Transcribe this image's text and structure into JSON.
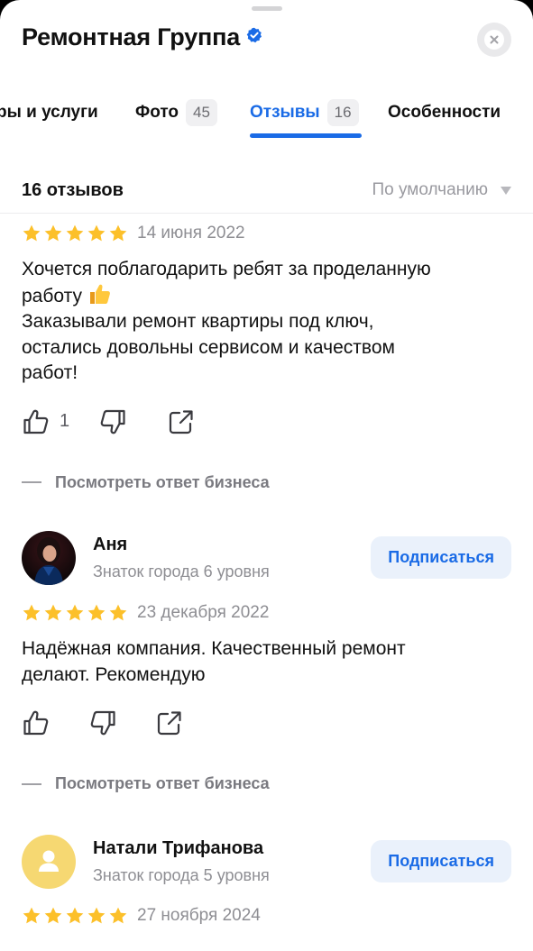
{
  "header": {
    "title": "Ремонтная Группа",
    "verified_icon": "verified-check-icon",
    "close_icon": "close-icon"
  },
  "tabs": [
    {
      "label": "ры и услуги",
      "count": ""
    },
    {
      "label": "Фото",
      "count": "45"
    },
    {
      "label": "Отзывы",
      "count": "16",
      "active": true
    },
    {
      "label": "Особенности",
      "count": ""
    }
  ],
  "reviews_header": {
    "count_label": "16 отзывов",
    "sort_label": "По умолчанию"
  },
  "reviews": [
    {
      "rating": 5,
      "date": "14 июня 2022",
      "text_line1": "Хочется поблагодарить ребят за проделанную",
      "text_line2": "работу",
      "text_rest": "Заказывали ремонт квартиры под ключ,\nостались довольны сервисом и качеством\nработ!",
      "likes": "1",
      "reply_label": "Посмотреть ответ бизнеса"
    },
    {
      "author": "Аня",
      "level": "Знаток города 6 уровня",
      "subscribe_label": "Подписаться",
      "rating": 5,
      "date": "23 декабря 2022",
      "text": "Надёжная компания. Качественный ремонт\nделают.  Рекомендую",
      "reply_label": "Посмотреть ответ бизнеса"
    },
    {
      "author": "Натали Трифанова",
      "level": "Знаток города 5 уровня",
      "subscribe_label": "Подписаться",
      "rating": 5,
      "date": "27 ноября 2024"
    }
  ],
  "colors": {
    "accent": "#1a6be6",
    "star": "#fcc02a",
    "muted": "#8e8e93",
    "avatar_placeholder": "#f6d872"
  }
}
